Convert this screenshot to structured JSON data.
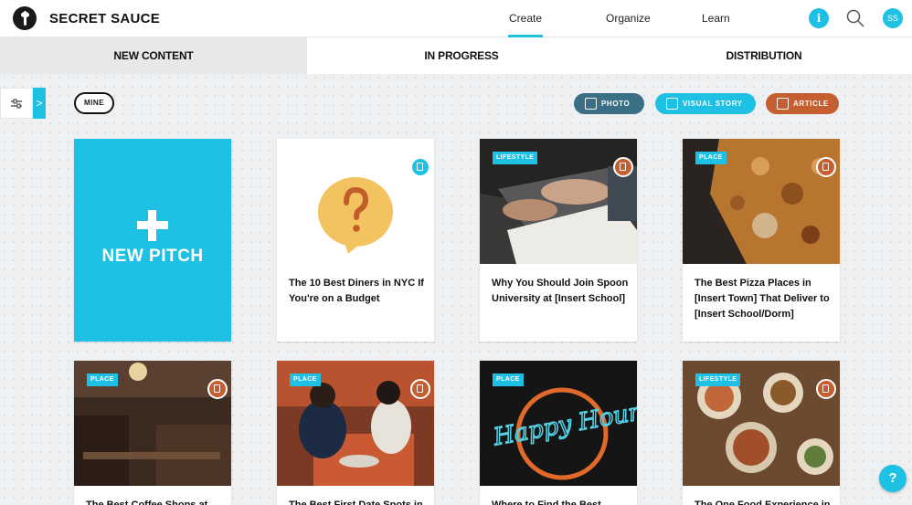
{
  "app": {
    "brand": "SECRET SAUCE"
  },
  "nav": {
    "create": "Create",
    "organize": "Organize",
    "learn": "Learn"
  },
  "header": {
    "info_glyph": "i",
    "avatar_initials": "SS"
  },
  "tabs": {
    "new_content": "NEW CONTENT",
    "in_progress": "IN PROGRESS",
    "distribution": "DISTRIBUTION"
  },
  "filters": {
    "toggle_glyph": ">",
    "mine": "MINE",
    "photo": "PHOTO",
    "visual_story": "VISUAL STORY",
    "article": "ARTICLE"
  },
  "new_pitch": {
    "label": "NEW PITCH"
  },
  "cards": [
    {
      "tag": "",
      "type": "visual-story",
      "title": "The 10 Best Diners in NYC If You're on a Budget"
    },
    {
      "tag": "LIFESTYLE",
      "type": "article",
      "title": "Why You Should Join Spoon University at [Insert School]"
    },
    {
      "tag": "PLACE",
      "type": "article",
      "title": "The Best Pizza Places in [Insert Town] That Deliver to [Insert School/Dorm]"
    },
    {
      "tag": "PLACE",
      "type": "article",
      "title": "The Best Coffee Shops at"
    },
    {
      "tag": "PLACE",
      "type": "article",
      "title": "The Best First Date Spots in"
    },
    {
      "tag": "PLACE",
      "type": "article",
      "title": "Where to Find the Best"
    },
    {
      "tag": "LIFESTYLE",
      "type": "article",
      "title": "The One Food Experience in"
    }
  ],
  "image_text": {
    "happy_hour_sign": "Happy Hour"
  },
  "help": {
    "glyph": "?"
  },
  "colors": {
    "accent": "#1ec0e4",
    "photo": "#3a6f86",
    "article": "#c55e31",
    "background": "#eef0f1"
  }
}
